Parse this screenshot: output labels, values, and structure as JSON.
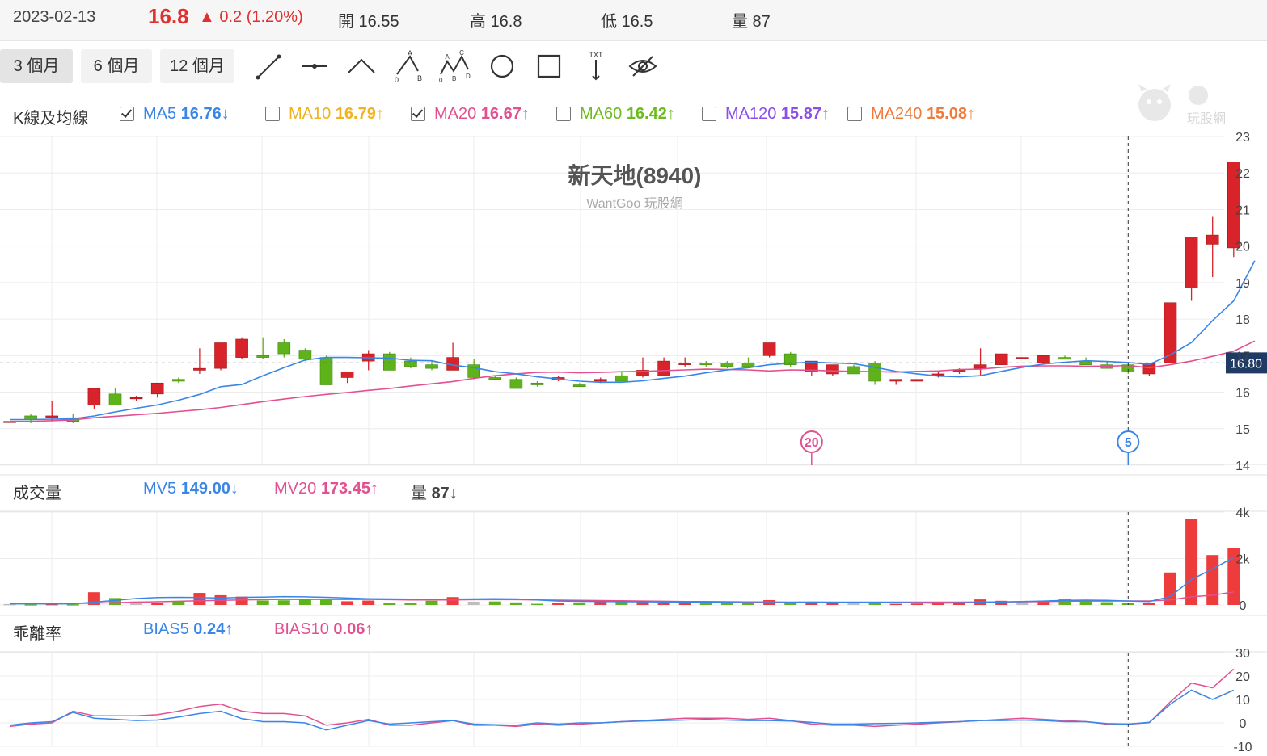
{
  "header": {
    "date": "2023-02-13",
    "price": "16.8",
    "change": "▲ 0.2 (1.20%)",
    "open": "開 16.55",
    "high": "高 16.8",
    "low": "低 16.5",
    "volume": "量 87"
  },
  "toolbar": {
    "ranges": [
      "3 個月",
      "6 個月",
      "12 個月"
    ],
    "active_range": "3 個月",
    "tools": [
      "line-tool-icon",
      "segment-tool-icon",
      "angle-tool-icon",
      "abc-pattern-icon",
      "abcd-pattern-icon",
      "circle-tool-icon",
      "rectangle-tool-icon",
      "text-tool-icon",
      "hide-drawings-icon"
    ],
    "tool_text": {
      "a": "A",
      "b": "B",
      "c": "C",
      "d": "D",
      "zero": "0",
      "txt": "TXT"
    }
  },
  "ma_legend": {
    "title": "K線及均線",
    "items": [
      {
        "name": "MA5",
        "value": "16.76",
        "arrow": "↓",
        "checked": true,
        "color": "#3a86e8"
      },
      {
        "name": "MA10",
        "value": "16.79",
        "arrow": "↑",
        "checked": false,
        "color": "#f2b21c"
      },
      {
        "name": "MA20",
        "value": "16.67",
        "arrow": "↑",
        "checked": true,
        "color": "#e2508f"
      },
      {
        "name": "MA60",
        "value": "16.42",
        "arrow": "↑",
        "checked": false,
        "color": "#6cbb1d"
      },
      {
        "name": "MA120",
        "value": "15.87",
        "arrow": "↑",
        "checked": false,
        "color": "#8e4ee8"
      },
      {
        "name": "MA240",
        "value": "15.08",
        "arrow": "↑",
        "checked": false,
        "color": "#f07a3a"
      }
    ]
  },
  "volume_legend": {
    "title": "成交量",
    "items": [
      {
        "name": "MV5",
        "value": "149.00",
        "arrow": "↓",
        "color": "#3a86e8"
      },
      {
        "name": "MV20",
        "value": "173.45",
        "arrow": "↑",
        "color": "#e2508f"
      },
      {
        "name": "量",
        "value": "87",
        "arrow": "↓",
        "color": "#444"
      }
    ]
  },
  "bias_legend": {
    "title": "乖離率",
    "items": [
      {
        "name": "BIAS5",
        "value": "0.24",
        "arrow": "↑",
        "color": "#3a86e8"
      },
      {
        "name": "BIAS10",
        "value": "0.06",
        "arrow": "↑",
        "color": "#e2508f"
      }
    ]
  },
  "watermark": {
    "title": "新天地(8940)",
    "subtitle": "WantGoo 玩股網",
    "logo_text": "玩股網"
  },
  "colors": {
    "up": "#d9232a",
    "down": "#5fb31a",
    "neutral": "#bdbdbd",
    "ma5": "#3a86e8",
    "ma20": "#e2508f",
    "grid": "#ececec"
  },
  "chart_data": {
    "type": "candlestick",
    "title": "新天地(8940)",
    "y_ticks": [
      "23",
      "22",
      "21",
      "20",
      "19",
      "18",
      "17",
      "16",
      "15",
      "14"
    ],
    "ylim": [
      14,
      23
    ],
    "last_price_label": "16.80",
    "markers": [
      {
        "label": "20",
        "index": 38,
        "color": "#e2508f"
      },
      {
        "label": "5",
        "index": 53,
        "color": "#3a86e8"
      }
    ],
    "crosshair_index": 53,
    "crosshair_price": 16.8,
    "candles": [
      [
        15.2,
        15.2,
        15.2,
        15.2
      ],
      [
        15.35,
        15.4,
        15.15,
        15.25
      ],
      [
        15.3,
        15.75,
        15.2,
        15.35
      ],
      [
        15.3,
        15.4,
        15.15,
        15.2
      ],
      [
        15.65,
        16.05,
        15.55,
        16.1
      ],
      [
        15.95,
        16.1,
        15.65,
        15.65
      ],
      [
        15.85,
        15.9,
        15.75,
        15.85
      ],
      [
        15.95,
        16.2,
        15.85,
        16.25
      ],
      [
        16.35,
        16.4,
        16.25,
        16.3
      ],
      [
        16.6,
        17.2,
        16.5,
        16.65
      ],
      [
        16.65,
        17.35,
        16.6,
        17.35
      ],
      [
        16.95,
        17.5,
        16.9,
        17.45
      ],
      [
        17.0,
        17.5,
        16.9,
        16.95
      ],
      [
        17.35,
        17.45,
        16.95,
        17.05
      ],
      [
        17.15,
        17.2,
        16.85,
        16.9
      ],
      [
        16.95,
        17.0,
        16.25,
        16.2
      ],
      [
        16.4,
        16.5,
        16.25,
        16.55
      ],
      [
        16.85,
        17.15,
        16.6,
        17.05
      ],
      [
        17.05,
        17.1,
        16.6,
        16.6
      ],
      [
        16.85,
        16.95,
        16.65,
        16.7
      ],
      [
        16.75,
        16.85,
        16.6,
        16.65
      ],
      [
        16.6,
        17.35,
        16.6,
        16.95
      ],
      [
        16.75,
        16.9,
        16.35,
        16.4
      ],
      [
        16.4,
        16.45,
        16.35,
        16.35
      ],
      [
        16.35,
        16.4,
        16.1,
        16.1
      ],
      [
        16.25,
        16.3,
        16.15,
        16.2
      ],
      [
        16.35,
        16.45,
        16.3,
        16.4
      ],
      [
        16.2,
        16.25,
        16.15,
        16.15
      ],
      [
        16.3,
        16.4,
        16.25,
        16.35
      ],
      [
        16.45,
        16.55,
        16.35,
        16.3
      ],
      [
        16.45,
        16.95,
        16.4,
        16.6
      ],
      [
        16.45,
        16.95,
        16.5,
        16.85
      ],
      [
        16.75,
        16.95,
        16.7,
        16.8
      ],
      [
        16.8,
        16.85,
        16.7,
        16.75
      ],
      [
        16.8,
        16.85,
        16.65,
        16.7
      ],
      [
        16.8,
        16.95,
        16.75,
        16.7
      ],
      [
        17.0,
        17.05,
        16.95,
        17.35
      ],
      [
        17.05,
        17.1,
        16.7,
        16.75
      ],
      [
        16.55,
        16.55,
        16.45,
        16.85
      ],
      [
        16.5,
        16.55,
        16.45,
        16.75
      ],
      [
        16.7,
        16.75,
        16.55,
        16.5
      ],
      [
        16.8,
        16.85,
        16.2,
        16.3
      ],
      [
        16.3,
        16.35,
        16.2,
        16.35
      ],
      [
        16.3,
        16.35,
        16.3,
        16.35
      ],
      [
        16.45,
        16.55,
        16.4,
        16.5
      ],
      [
        16.55,
        16.65,
        16.5,
        16.6
      ],
      [
        16.65,
        17.2,
        16.45,
        16.75
      ],
      [
        16.75,
        16.8,
        16.75,
        17.05
      ],
      [
        16.95,
        16.95,
        16.95,
        16.95
      ],
      [
        16.8,
        16.95,
        16.75,
        17.0
      ],
      [
        16.95,
        17.0,
        16.95,
        16.9
      ],
      [
        16.85,
        16.95,
        16.8,
        16.75
      ],
      [
        16.75,
        16.85,
        16.65,
        16.65
      ],
      [
        16.75,
        16.8,
        16.5,
        16.55
      ],
      [
        16.5,
        16.55,
        16.45,
        16.8
      ],
      [
        16.8,
        18.45,
        16.8,
        18.45
      ],
      [
        18.85,
        20.25,
        18.5,
        20.25
      ],
      [
        20.05,
        20.8,
        19.15,
        20.3
      ],
      [
        19.95,
        22.3,
        19.7,
        22.3
      ]
    ],
    "ma5": [
      15.25,
      15.25,
      15.26,
      15.27,
      15.35,
      15.46,
      15.56,
      15.65,
      15.78,
      15.94,
      16.15,
      16.21,
      16.45,
      16.67,
      16.88,
      16.95,
      16.95,
      16.94,
      16.93,
      16.87,
      16.86,
      16.74,
      16.67,
      16.56,
      16.5,
      16.42,
      16.36,
      16.3,
      16.27,
      16.27,
      16.31,
      16.38,
      16.44,
      16.53,
      16.61,
      16.67,
      16.75,
      16.79,
      16.82,
      16.8,
      16.78,
      16.68,
      16.57,
      16.5,
      16.44,
      16.42,
      16.45,
      16.57,
      16.68,
      16.77,
      16.82,
      16.86,
      16.84,
      16.81,
      16.76,
      17.02,
      17.36,
      17.96,
      18.5,
      19.6
    ],
    "ma20": [
      15.2,
      15.2,
      15.22,
      15.24,
      15.3,
      15.34,
      15.38,
      15.42,
      15.47,
      15.52,
      15.58,
      15.66,
      15.74,
      15.81,
      15.88,
      15.94,
      15.99,
      16.05,
      16.1,
      16.17,
      16.23,
      16.29,
      16.38,
      16.45,
      16.5,
      16.54,
      16.55,
      16.53,
      16.54,
      16.56,
      16.57,
      16.59,
      16.61,
      16.63,
      16.62,
      16.61,
      16.58,
      16.61,
      16.6,
      16.58,
      16.57,
      16.56,
      16.55,
      16.57,
      16.58,
      16.62,
      16.63,
      16.68,
      16.71,
      16.72,
      16.72,
      16.71,
      16.71,
      16.73,
      16.67,
      16.75,
      16.85,
      16.98,
      17.12,
      17.4
    ],
    "volume": {
      "y_ticks": [
        "4k",
        "2k",
        "0"
      ],
      "ylim": [
        0,
        4000
      ],
      "bars": [
        40,
        30,
        40,
        30,
        550,
        300,
        150,
        90,
        140,
        520,
        420,
        360,
        190,
        200,
        250,
        220,
        160,
        190,
        90,
        80,
        180,
        340,
        140,
        150,
        110,
        50,
        90,
        110,
        170,
        130,
        140,
        110,
        80,
        90,
        70,
        80,
        210,
        110,
        90,
        80,
        90,
        70,
        50,
        60,
        120,
        100,
        240,
        180,
        140,
        180,
        270,
        160,
        120,
        100,
        87,
        1400,
        3700,
        2150,
        2450
      ],
      "mv5": [
        50,
        50,
        50,
        50,
        120,
        200,
        280,
        320,
        330,
        320,
        300,
        330,
        340,
        360,
        350,
        330,
        300,
        270,
        260,
        250,
        240,
        250,
        260,
        270,
        260,
        220,
        170,
        160,
        150,
        140,
        140,
        130,
        130,
        120,
        110,
        100,
        100,
        110,
        120,
        110,
        110,
        110,
        110,
        90,
        80,
        90,
        110,
        130,
        150,
        170,
        200,
        210,
        200,
        170,
        149,
        360,
        1100,
        1550,
        2050
      ],
      "mv20": [
        60,
        60,
        60,
        60,
        80,
        100,
        120,
        140,
        160,
        180,
        200,
        220,
        230,
        240,
        240,
        240,
        240,
        240,
        230,
        220,
        220,
        220,
        230,
        230,
        230,
        220,
        210,
        200,
        190,
        180,
        170,
        160,
        150,
        150,
        140,
        130,
        130,
        120,
        120,
        120,
        120,
        120,
        120,
        120,
        120,
        120,
        125,
        130,
        140,
        150,
        160,
        170,
        170,
        173,
        173,
        220,
        350,
        420,
        560
      ]
    },
    "bias": {
      "y_ticks": [
        "30",
        "20",
        "10",
        "0",
        "-10"
      ],
      "ylim": [
        -10,
        30
      ],
      "bias5": [
        -1,
        0,
        0.5,
        4.5,
        2,
        1.5,
        1,
        1.2,
        2.5,
        4,
        5,
        1.8,
        0.5,
        0.5,
        0,
        -3,
        -1,
        1,
        -0.5,
        0,
        0.5,
        1,
        -0.5,
        -0.8,
        -1,
        0,
        -0.5,
        0,
        0,
        0.5,
        0.8,
        1,
        1.2,
        1.5,
        1.2,
        1,
        1,
        0.8,
        0.2,
        -0.5,
        -0.5,
        -0.3,
        -0.2,
        0,
        0.3,
        0.5,
        1,
        1,
        1.2,
        1,
        0.5,
        0.5,
        -0.3,
        -0.5,
        0.24,
        8,
        14,
        10,
        14
      ],
      "bias10": [
        -1.5,
        -0.5,
        0,
        5,
        3,
        3,
        3,
        3.5,
        5,
        7,
        8,
        5,
        4,
        4,
        3,
        -1,
        0,
        1.5,
        -1,
        -1,
        0,
        1,
        -1,
        -1,
        -1.5,
        -0.5,
        -1,
        -0.5,
        0,
        0.5,
        1,
        1.5,
        2,
        2,
        2,
        1.5,
        2,
        1,
        -0.5,
        -1,
        -1,
        -1.5,
        -1,
        -0.5,
        0,
        0.5,
        1,
        1.5,
        2,
        1.5,
        1,
        0.5,
        -0.5,
        -0.5,
        0.06,
        9,
        17,
        15,
        23
      ]
    }
  }
}
